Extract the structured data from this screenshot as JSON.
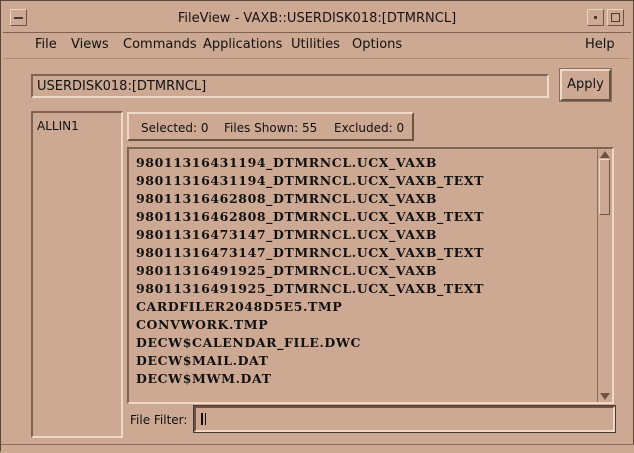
{
  "window": {
    "title": "FileView - VAXB::USERDISK018:[DTMRNCL]"
  },
  "menu": [
    {
      "label": "File"
    },
    {
      "label": "Views"
    },
    {
      "label": "Commands"
    },
    {
      "label": "Applications"
    },
    {
      "label": "Utilities"
    },
    {
      "label": "Options"
    },
    {
      "label": "Help"
    }
  ],
  "path": {
    "value": "USERDISK018:[DTMRNCL]"
  },
  "apply_label": "Apply",
  "left_list": [
    "ALLIN1"
  ],
  "counts": {
    "selected_label": "Selected:",
    "selected": "0",
    "shown_label": "Files Shown:",
    "shown": "55",
    "excluded_label": "Excluded:",
    "excluded": "0"
  },
  "files": [
    "98011316431194_DTMRNCL.UCX_VAXB",
    "98011316431194_DTMRNCL.UCX_VAXB_TEXT",
    "98011316462808_DTMRNCL.UCX_VAXB",
    "98011316462808_DTMRNCL.UCX_VAXB_TEXT",
    "98011316473147_DTMRNCL.UCX_VAXB",
    "98011316473147_DTMRNCL.UCX_VAXB_TEXT",
    "98011316491925_DTMRNCL.UCX_VAXB",
    "98011316491925_DTMRNCL.UCX_VAXB_TEXT",
    "CARDFILER2048D5E5.TMP",
    "CONVWORK.TMP",
    "DECW$CALENDAR_FILE.DWC",
    "DECW$MAIL.DAT",
    "DECW$MWM.DAT"
  ],
  "filter": {
    "label": "File Filter:",
    "value": ""
  },
  "colors": {
    "background": "#cda993",
    "text": "#111111"
  }
}
